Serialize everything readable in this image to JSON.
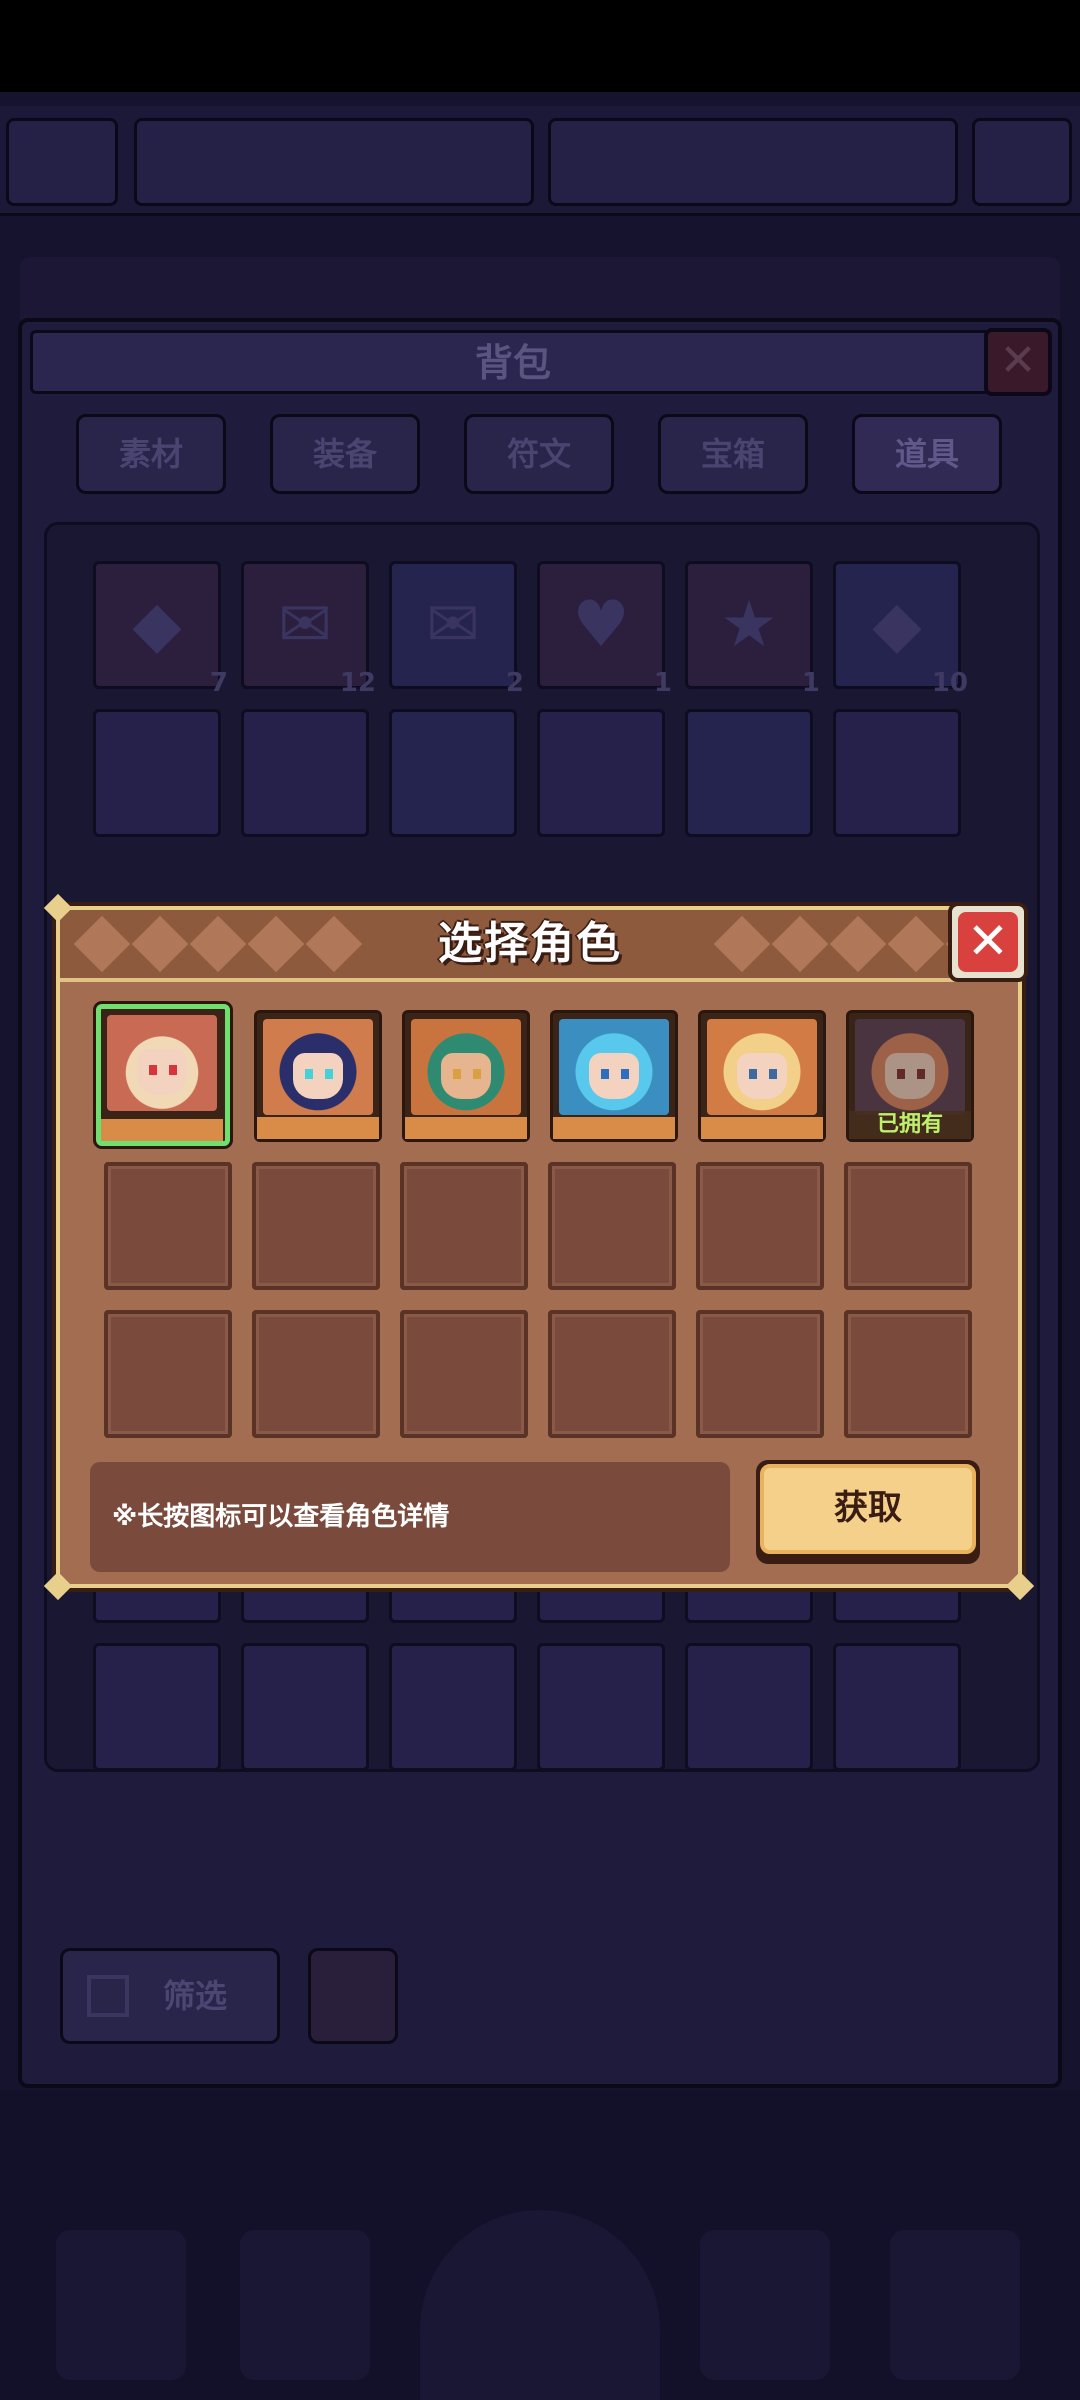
{
  "background_bag": {
    "title": "背包",
    "tabs": [
      "素材",
      "装备",
      "符文",
      "宝箱",
      "道具"
    ],
    "active_tab": "道具",
    "item_counts": [
      "7",
      "12",
      "2",
      "1",
      "1",
      "10"
    ],
    "filter_label": "筛选"
  },
  "modal": {
    "title": "选择角色",
    "close_icon": "close-icon",
    "characters": [
      {
        "name_hint": "character-1",
        "selected": true,
        "owned": false,
        "colors": {
          "hair": "#f0d9b4",
          "bg": "#c96a55",
          "accent": "#d8343a"
        }
      },
      {
        "name_hint": "character-2",
        "selected": false,
        "owned": false,
        "colors": {
          "hair": "#2a2e6a",
          "bg": "#d17c4d",
          "accent": "#46d0d8"
        }
      },
      {
        "name_hint": "character-3",
        "selected": false,
        "owned": false,
        "colors": {
          "hair": "#2f8a72",
          "bg": "#c9743f",
          "accent": "#d8a040"
        }
      },
      {
        "name_hint": "character-4",
        "selected": false,
        "owned": false,
        "colors": {
          "hair": "#58c8ec",
          "bg": "#3a8ec0",
          "accent": "#ffffff"
        }
      },
      {
        "name_hint": "character-5",
        "selected": false,
        "owned": false,
        "colors": {
          "hair": "#f3d08a",
          "bg": "#d27b44",
          "accent": "#ffffff"
        }
      },
      {
        "name_hint": "character-6",
        "selected": false,
        "owned": true,
        "colors": {
          "hair": "#e08a66",
          "bg": "#6a4a5a",
          "accent": "#f4c6d0"
        }
      }
    ],
    "owned_label": "已拥有",
    "hint": "※长按图标可以查看角色详情",
    "obtain_label": "获取"
  }
}
